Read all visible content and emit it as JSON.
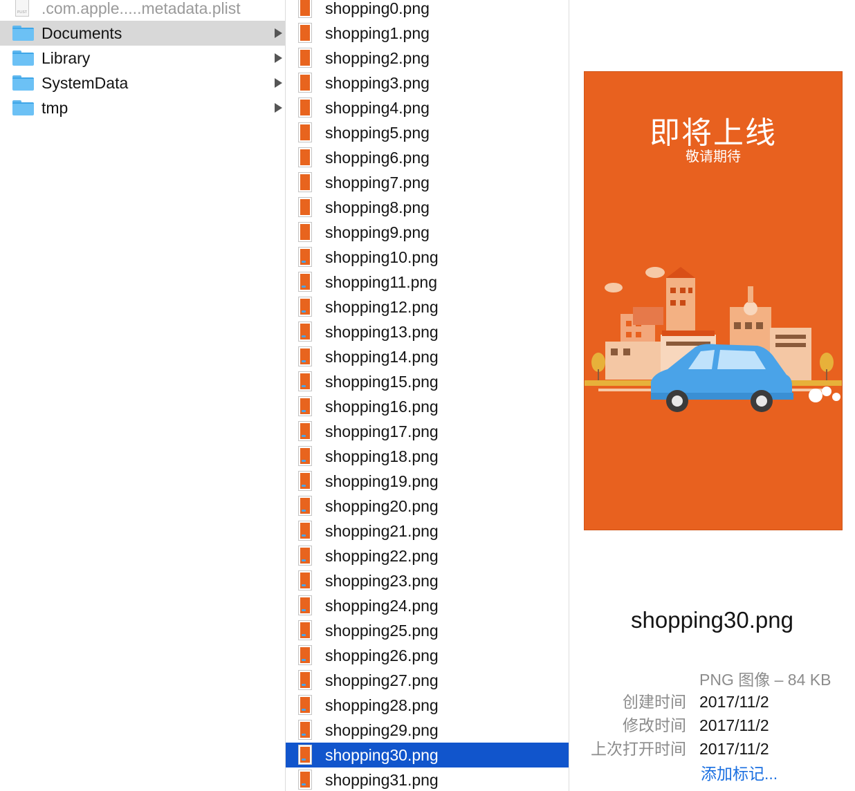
{
  "column1": {
    "items": [
      {
        "label": ".com.apple.....metadata.plist",
        "kind": "plist",
        "icon": "plist-file-icon"
      },
      {
        "label": "Documents",
        "kind": "folder",
        "icon": "folder-icon",
        "selected": true
      },
      {
        "label": "Library",
        "kind": "folder",
        "icon": "folder-icon"
      },
      {
        "label": "SystemData",
        "kind": "folder",
        "icon": "folder-icon"
      },
      {
        "label": "tmp",
        "kind": "folder",
        "icon": "folder-icon"
      }
    ],
    "plist_icon_tag": "PLIST"
  },
  "column2": {
    "files": [
      "shopping0.png",
      "shopping1.png",
      "shopping2.png",
      "shopping3.png",
      "shopping4.png",
      "shopping5.png",
      "shopping6.png",
      "shopping7.png",
      "shopping8.png",
      "shopping9.png",
      "shopping10.png",
      "shopping11.png",
      "shopping12.png",
      "shopping13.png",
      "shopping14.png",
      "shopping15.png",
      "shopping16.png",
      "shopping17.png",
      "shopping18.png",
      "shopping19.png",
      "shopping20.png",
      "shopping21.png",
      "shopping22.png",
      "shopping23.png",
      "shopping24.png",
      "shopping25.png",
      "shopping26.png",
      "shopping27.png",
      "shopping28.png",
      "shopping29.png",
      "shopping30.png",
      "shopping31.png"
    ],
    "selected_index": 30
  },
  "preview": {
    "headline": "即将上线",
    "subline": "敬请期待",
    "background_color": "#e8611f"
  },
  "info": {
    "filename": "shopping30.png",
    "kind": "PNG 图像 – 84 KB",
    "rows": [
      {
        "key": "创建时间",
        "value": "2017/11/2"
      },
      {
        "key": "修改时间",
        "value": "2017/11/2"
      },
      {
        "key": "上次打开时间",
        "value": "2017/11/2"
      }
    ],
    "add_tags": "添加标记..."
  },
  "colors": {
    "selection_blue": "#1155cc",
    "selection_gray": "#d8d8d8",
    "link_blue": "#1a6fe0"
  }
}
